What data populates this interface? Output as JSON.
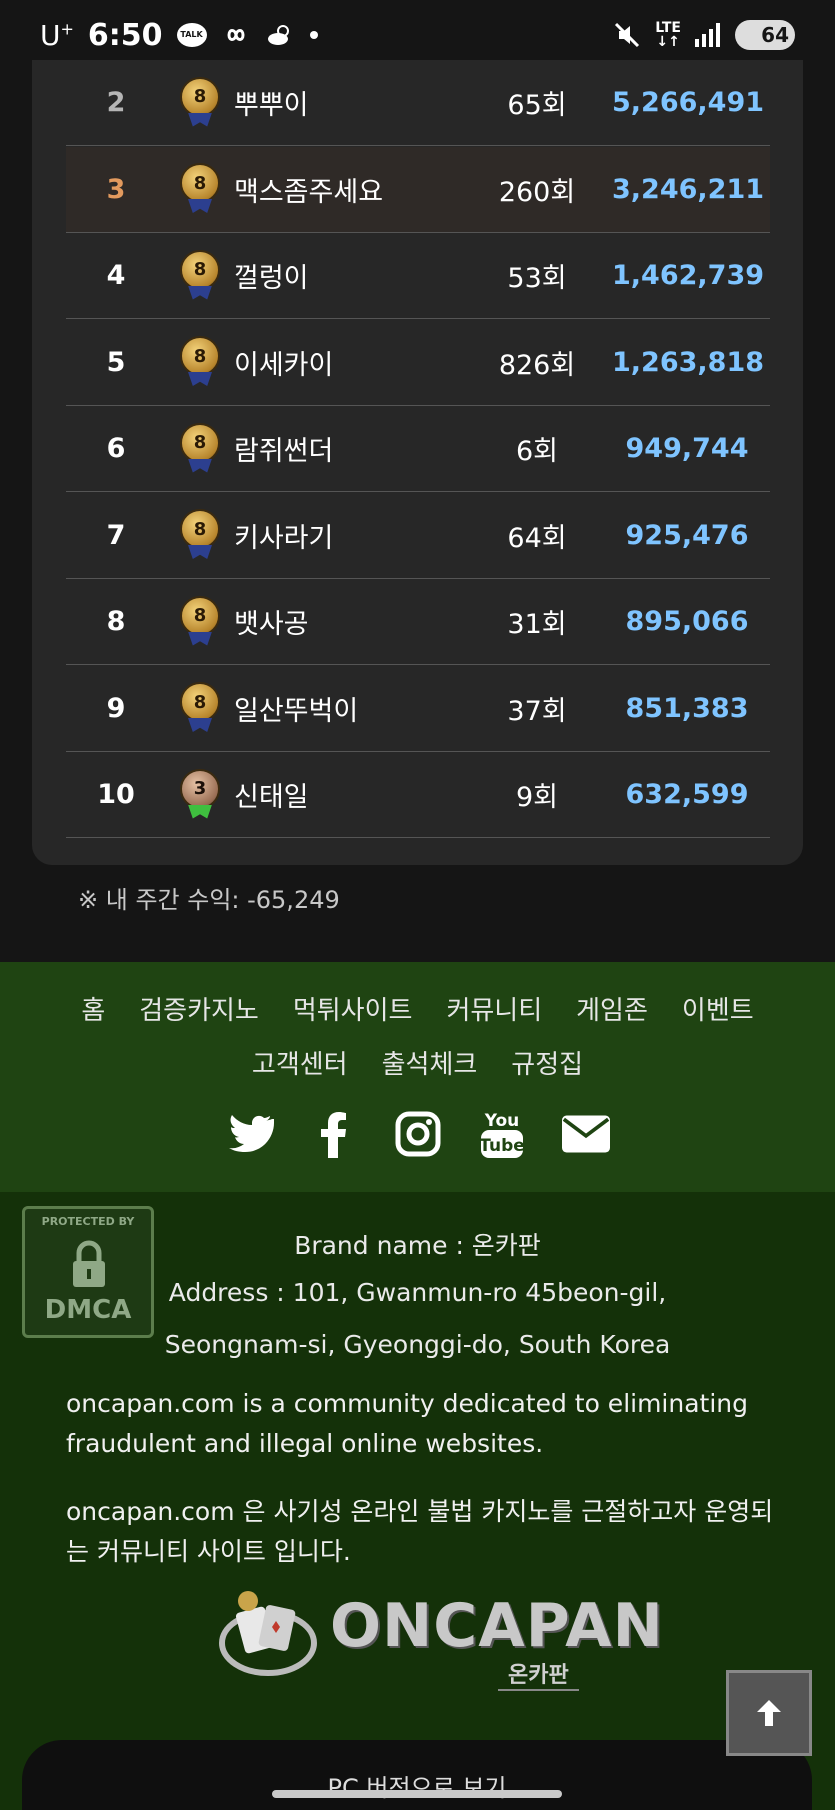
{
  "status_bar": {
    "carrier": "U",
    "carrier_sup": "+",
    "time": "6:50",
    "talk_label": "TALK",
    "network": "LTE",
    "battery": "64"
  },
  "ranking": {
    "rows": [
      {
        "rank": "2",
        "name": "뿌뿌이",
        "count": "65회",
        "amount": "5,266,491",
        "badge": "8",
        "tier": "gold",
        "rank_color": "silver"
      },
      {
        "rank": "3",
        "name": "맥스좀주세요",
        "count": "260회",
        "amount": "3,246,211",
        "badge": "8",
        "tier": "gold",
        "rank_color": "bronze"
      },
      {
        "rank": "4",
        "name": "껄렁이",
        "count": "53회",
        "amount": "1,462,739",
        "badge": "8",
        "tier": "gold",
        "rank_color": "white"
      },
      {
        "rank": "5",
        "name": "이세카이",
        "count": "826회",
        "amount": "1,263,818",
        "badge": "8",
        "tier": "gold",
        "rank_color": "white"
      },
      {
        "rank": "6",
        "name": "람쥐썬더",
        "count": "6회",
        "amount": "949,744",
        "badge": "8",
        "tier": "gold",
        "rank_color": "white"
      },
      {
        "rank": "7",
        "name": "키사라기",
        "count": "64회",
        "amount": "925,476",
        "badge": "8",
        "tier": "gold",
        "rank_color": "white"
      },
      {
        "rank": "8",
        "name": "뱃사공",
        "count": "31회",
        "amount": "895,066",
        "badge": "8",
        "tier": "gold",
        "rank_color": "white"
      },
      {
        "rank": "9",
        "name": "일산뚜벅이",
        "count": "37회",
        "amount": "851,383",
        "badge": "8",
        "tier": "gold",
        "rank_color": "white"
      },
      {
        "rank": "10",
        "name": "신태일",
        "count": "9회",
        "amount": "632,599",
        "badge": "3",
        "tier": "bronze",
        "rank_color": "white"
      }
    ],
    "my_income": "※ 내 주간 수익: -65,249"
  },
  "footer_nav": {
    "line1": [
      "홈",
      "검증카지노",
      "먹튀사이트",
      "커뮤니티",
      "게임존",
      "이벤트"
    ],
    "line2": [
      "고객센터",
      "출석체크",
      "규정집"
    ],
    "social_icons": [
      "twitter-icon",
      "facebook-icon",
      "instagram-icon",
      "youtube-icon",
      "mail-icon"
    ]
  },
  "footer_info": {
    "dmca_top": "PROTECTED BY",
    "dmca_bottom": "DMCA",
    "brand_line": "Brand name : 온카판",
    "address_line1": "Address : 101, Gwanmun-ro 45beon-gil,",
    "address_line2": "Seongnam-si, Gyeonggi-do, South Korea",
    "desc_en": "oncapan.com is a community dedicated to eliminating fraudulent and illegal online websites.",
    "desc_ko": "oncapan.com 은 사기성 온라인 불법 카지노를 근절하고자 운영되는 커뮤니티 사이트 입니다.",
    "logo_text": "ONCAPAN",
    "logo_sub": "온카판",
    "pc_button": "PC 버전으로 보기"
  },
  "colors": {
    "amount": "#7fc4ff",
    "nav_bg": "#1f4412",
    "info_bg": "#143109",
    "panel_bg": "#272727"
  }
}
